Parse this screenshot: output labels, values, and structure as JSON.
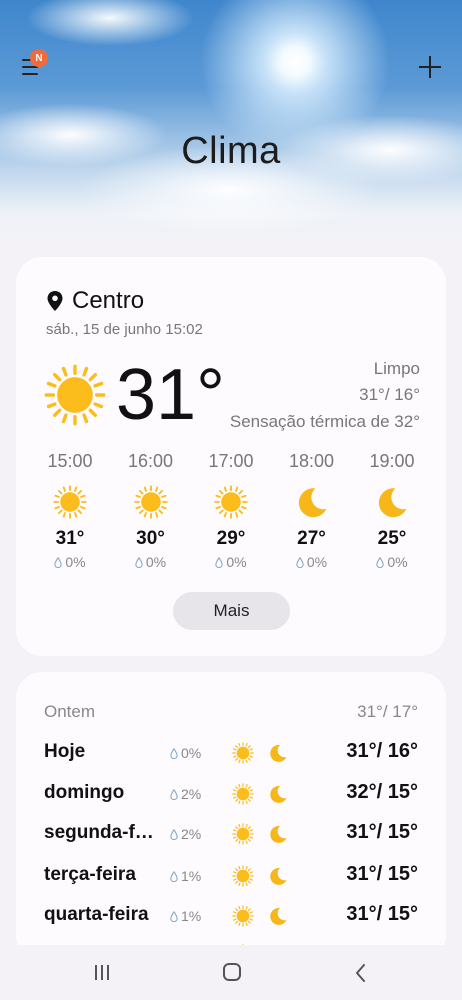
{
  "header": {
    "title": "Clima",
    "menu_icon": "hamburger-menu-icon",
    "notification_badge": "N",
    "add_icon": "plus-icon"
  },
  "current": {
    "location": "Centro",
    "datetime": "sáb., 15 de junho 15:02",
    "temperature": "31°",
    "condition": "Limpo",
    "high_low": "31°/ 16°",
    "feels_like": "Sensação térmica de 32°",
    "icon": "sun-icon",
    "hourly": [
      {
        "time": "15:00",
        "icon": "sun-icon",
        "temp": "31°",
        "precip": "0%"
      },
      {
        "time": "16:00",
        "icon": "sun-icon",
        "temp": "30°",
        "precip": "0%"
      },
      {
        "time": "17:00",
        "icon": "sun-icon",
        "temp": "29°",
        "precip": "0%"
      },
      {
        "time": "18:00",
        "icon": "moon-icon",
        "temp": "27°",
        "precip": "0%"
      },
      {
        "time": "19:00",
        "icon": "moon-icon",
        "temp": "25°",
        "precip": "0%"
      }
    ],
    "more_label": "Mais"
  },
  "forecast": {
    "yesterday": {
      "label": "Ontem",
      "range": "31°/ 17°"
    },
    "days": [
      {
        "name": "Hoje",
        "precip": "0%",
        "range": "31°/ 16°"
      },
      {
        "name": "domingo",
        "precip": "2%",
        "range": "32°/ 15°"
      },
      {
        "name": "segunda-feira",
        "precip": "2%",
        "range": "31°/ 15°"
      },
      {
        "name": "terça-feira",
        "precip": "1%",
        "range": "31°/ 15°"
      },
      {
        "name": "quarta-feira",
        "precip": "1%",
        "range": "31°/ 15°"
      }
    ]
  },
  "colors": {
    "sun": "#fbbc1c",
    "moon": "#f7b718",
    "badge": "#f06a3a",
    "card": "#fdfbfe",
    "background": "#f4f2f6"
  }
}
